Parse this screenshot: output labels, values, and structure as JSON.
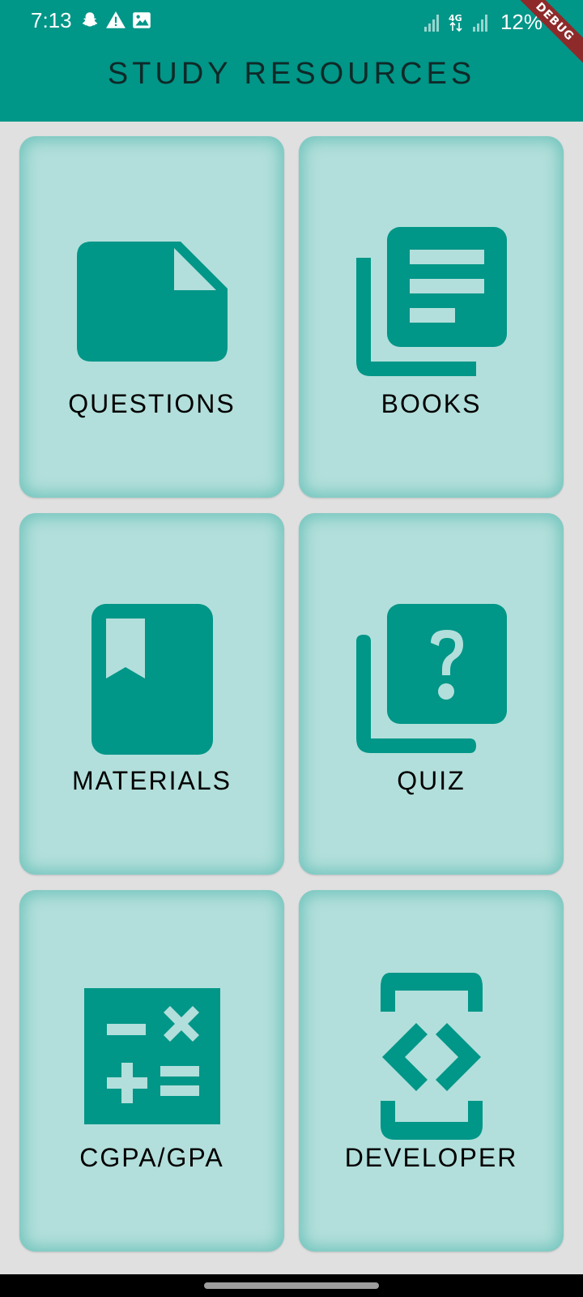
{
  "status_bar": {
    "time": "7:13",
    "left_icons": [
      "snapchat-icon",
      "warning-icon",
      "image-icon"
    ],
    "right_icons": [
      "signal-icon",
      "network-4g-icon",
      "signal-icon"
    ],
    "battery": "12%"
  },
  "debug_banner": "DEBUG",
  "app_bar": {
    "title": "STUDY RESOURCES"
  },
  "cards": [
    {
      "label": "QUESTIONS",
      "icon": "document-icon"
    },
    {
      "label": "BOOKS",
      "icon": "library-books-icon"
    },
    {
      "label": "MATERIALS",
      "icon": "book-bookmark-icon"
    },
    {
      "label": "QUIZ",
      "icon": "quiz-icon"
    },
    {
      "label": "CGPA/GPA",
      "icon": "calculator-icon"
    },
    {
      "label": "DEVELOPER",
      "icon": "developer-mode-icon"
    }
  ],
  "colors": {
    "primary": "#009688",
    "card_background": "#b2dfdb",
    "page_background": "#e0e0e0"
  }
}
